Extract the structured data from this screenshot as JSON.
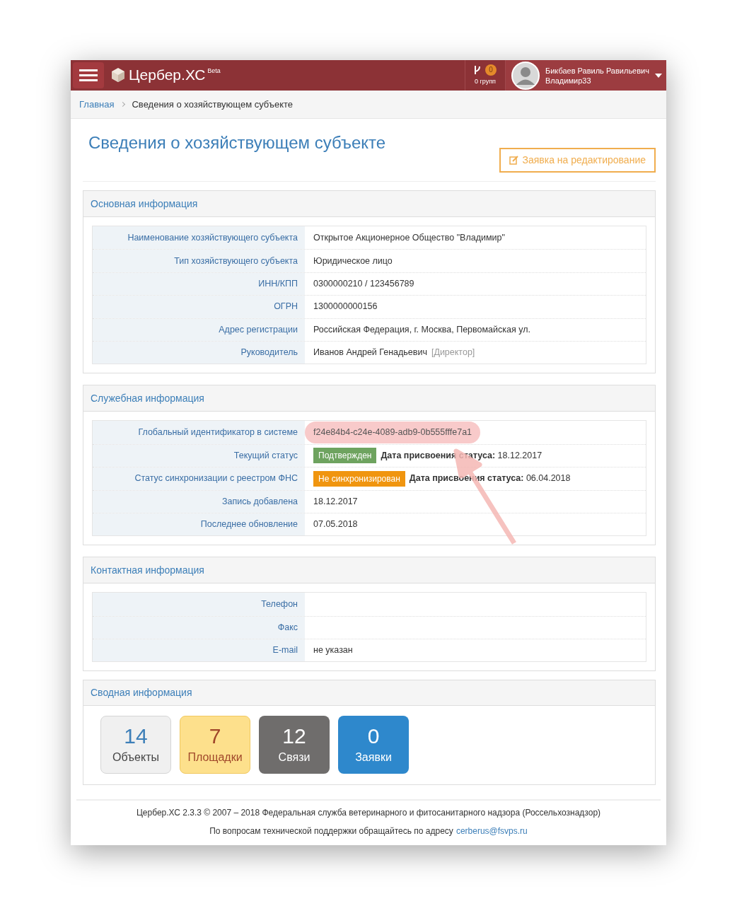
{
  "header": {
    "brand": "Цербер.ХС",
    "brand_tag": "Beta",
    "group_count": "0",
    "groups_label": "0 групп",
    "user_name": "Бикбаев Равиль Равильевич",
    "user_org": "Владимир33"
  },
  "breadcrumb": [
    {
      "label": "Главная",
      "link": true
    },
    {
      "label": "Сведения о хозяйствующем субъекте",
      "link": false
    }
  ],
  "title": "Сведения о хозяйствующем субъекте",
  "edit_button": "Заявка на редактирование",
  "sections": [
    {
      "title": "Основная информация",
      "rows": [
        {
          "label": "Наименование хозяйствующего субъекта",
          "value": [
            {
              "kind": "text",
              "text": "Открытое Акционерное Общество \"Владимир\""
            }
          ]
        },
        {
          "label": "Тип хозяйствующего субъекта",
          "value": [
            {
              "kind": "text",
              "text": "Юридическое лицо"
            }
          ]
        },
        {
          "label": "ИНН/КПП",
          "value": [
            {
              "kind": "text",
              "text": "0300000210 / 123456789"
            }
          ]
        },
        {
          "label": "ОГРН",
          "value": [
            {
              "kind": "text",
              "text": "1300000000156"
            }
          ]
        },
        {
          "label": "Адрес регистрации",
          "value": [
            {
              "kind": "text",
              "text": "Российская Федерация, г. Москва, Первомайская ул."
            }
          ]
        },
        {
          "label": "Руководитель",
          "value": [
            {
              "kind": "text",
              "text": "Иванов Андрей Генадьевич"
            },
            {
              "kind": "note",
              "text": "[Директор]"
            }
          ]
        }
      ]
    },
    {
      "title": "Служебная информация",
      "rows": [
        {
          "label": "Глобальный идентификатор в системе",
          "highlighted": true,
          "value": [
            {
              "kind": "text",
              "text": "f24e84b4-c24e-4089-adb9-0b555fffe7a1"
            }
          ]
        },
        {
          "label": "Текущий статус",
          "value": [
            {
              "kind": "badge",
              "text": "Подтвержден",
              "color": "#6ea35f"
            },
            {
              "kind": "text",
              "text": "**Дата присвоения статуса:** 18.12.2017"
            }
          ]
        },
        {
          "label": "Статус синхронизации с реестром ФНС",
          "value": [
            {
              "kind": "badge",
              "text": "Не синхронизирован",
              "color": "#f0950f"
            },
            {
              "kind": "text",
              "text": "**Дата присвоения статуса:** 06.04.2018"
            }
          ]
        },
        {
          "label": "Запись добавлена",
          "value": [
            {
              "kind": "text",
              "text": "18.12.2017"
            }
          ]
        },
        {
          "label": "Последнее обновление",
          "value": [
            {
              "kind": "text",
              "text": "07.05.2018"
            }
          ]
        }
      ]
    },
    {
      "title": "Контактная информация",
      "rows": [
        {
          "label": "Телефон"
        },
        {
          "label": "Факс"
        },
        {
          "label": "E-mail",
          "value": [
            {
              "kind": "text",
              "text": "не указан"
            }
          ]
        }
      ]
    }
  ],
  "summary": {
    "title": "Сводная информация",
    "tiles": [
      {
        "kind": "light",
        "count": "14",
        "label": "Объекты"
      },
      {
        "kind": "yellow",
        "count": "7",
        "label": "Площадки"
      },
      {
        "kind": "dark",
        "count": "12",
        "label": "Связи"
      },
      {
        "kind": "blue",
        "count": "0",
        "label": "Заявки"
      }
    ]
  },
  "footer": {
    "copyright": "Цербер.ХС 2.3.3 © 2007 – 2018 Федеральная служба ветеринарного и фитосанитарного надзора (Россельхознадзор)",
    "support_text": "По вопросам технической поддержки обращайтесь по адресу",
    "support_link": "cerberus@fsvps.ru"
  }
}
